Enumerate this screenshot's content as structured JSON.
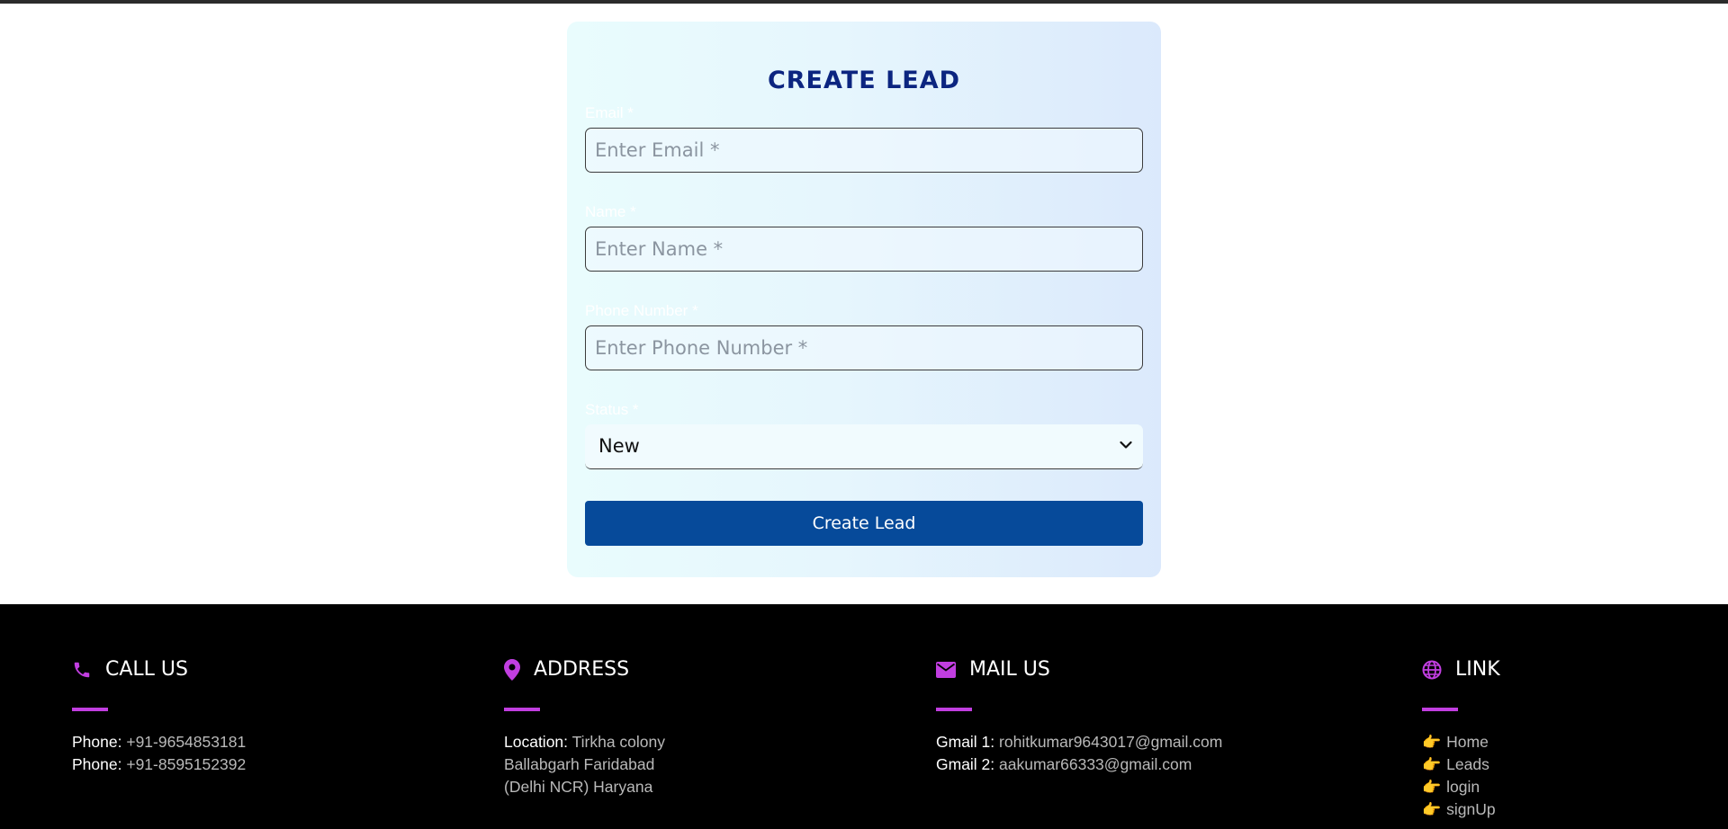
{
  "form": {
    "title": "CREATE LEAD",
    "email": {
      "label": "Email *",
      "placeholder": "Enter Email *",
      "value": ""
    },
    "name": {
      "label": "Name *",
      "placeholder": "Enter Name *",
      "value": ""
    },
    "phone": {
      "label": "Phone Number *",
      "placeholder": "Enter Phone Number *",
      "value": ""
    },
    "status": {
      "label": "Status *",
      "selected": "New"
    },
    "submit_label": "Create Lead"
  },
  "footer": {
    "call": {
      "title": "CALL US",
      "icon": "phone-icon",
      "lines": [
        {
          "key": "Phone:",
          "value": "+91-9654853181"
        },
        {
          "key": "Phone:",
          "value": "+91-8595152392"
        }
      ]
    },
    "address": {
      "title": "ADDRESS",
      "icon": "location-pin-icon",
      "key": "Location:",
      "lines": [
        "Tirkha colony",
        "Ballabgarh Faridabad",
        "(Delhi NCR) Haryana"
      ]
    },
    "mail": {
      "title": "MAIL US",
      "icon": "envelope-icon",
      "lines": [
        {
          "key": "Gmail 1:",
          "value": "rohitkumar9643017@gmail.com"
        },
        {
          "key": "Gmail 2:",
          "value": "aakumar66333@gmail.com"
        }
      ]
    },
    "links": {
      "title": "LINK",
      "icon": "globe-icon",
      "items": [
        "Home",
        "Leads",
        "login",
        "signUp"
      ]
    }
  },
  "colors": {
    "accent": "#c13ee0",
    "button": "#064a9a",
    "title": "#0c2580"
  }
}
